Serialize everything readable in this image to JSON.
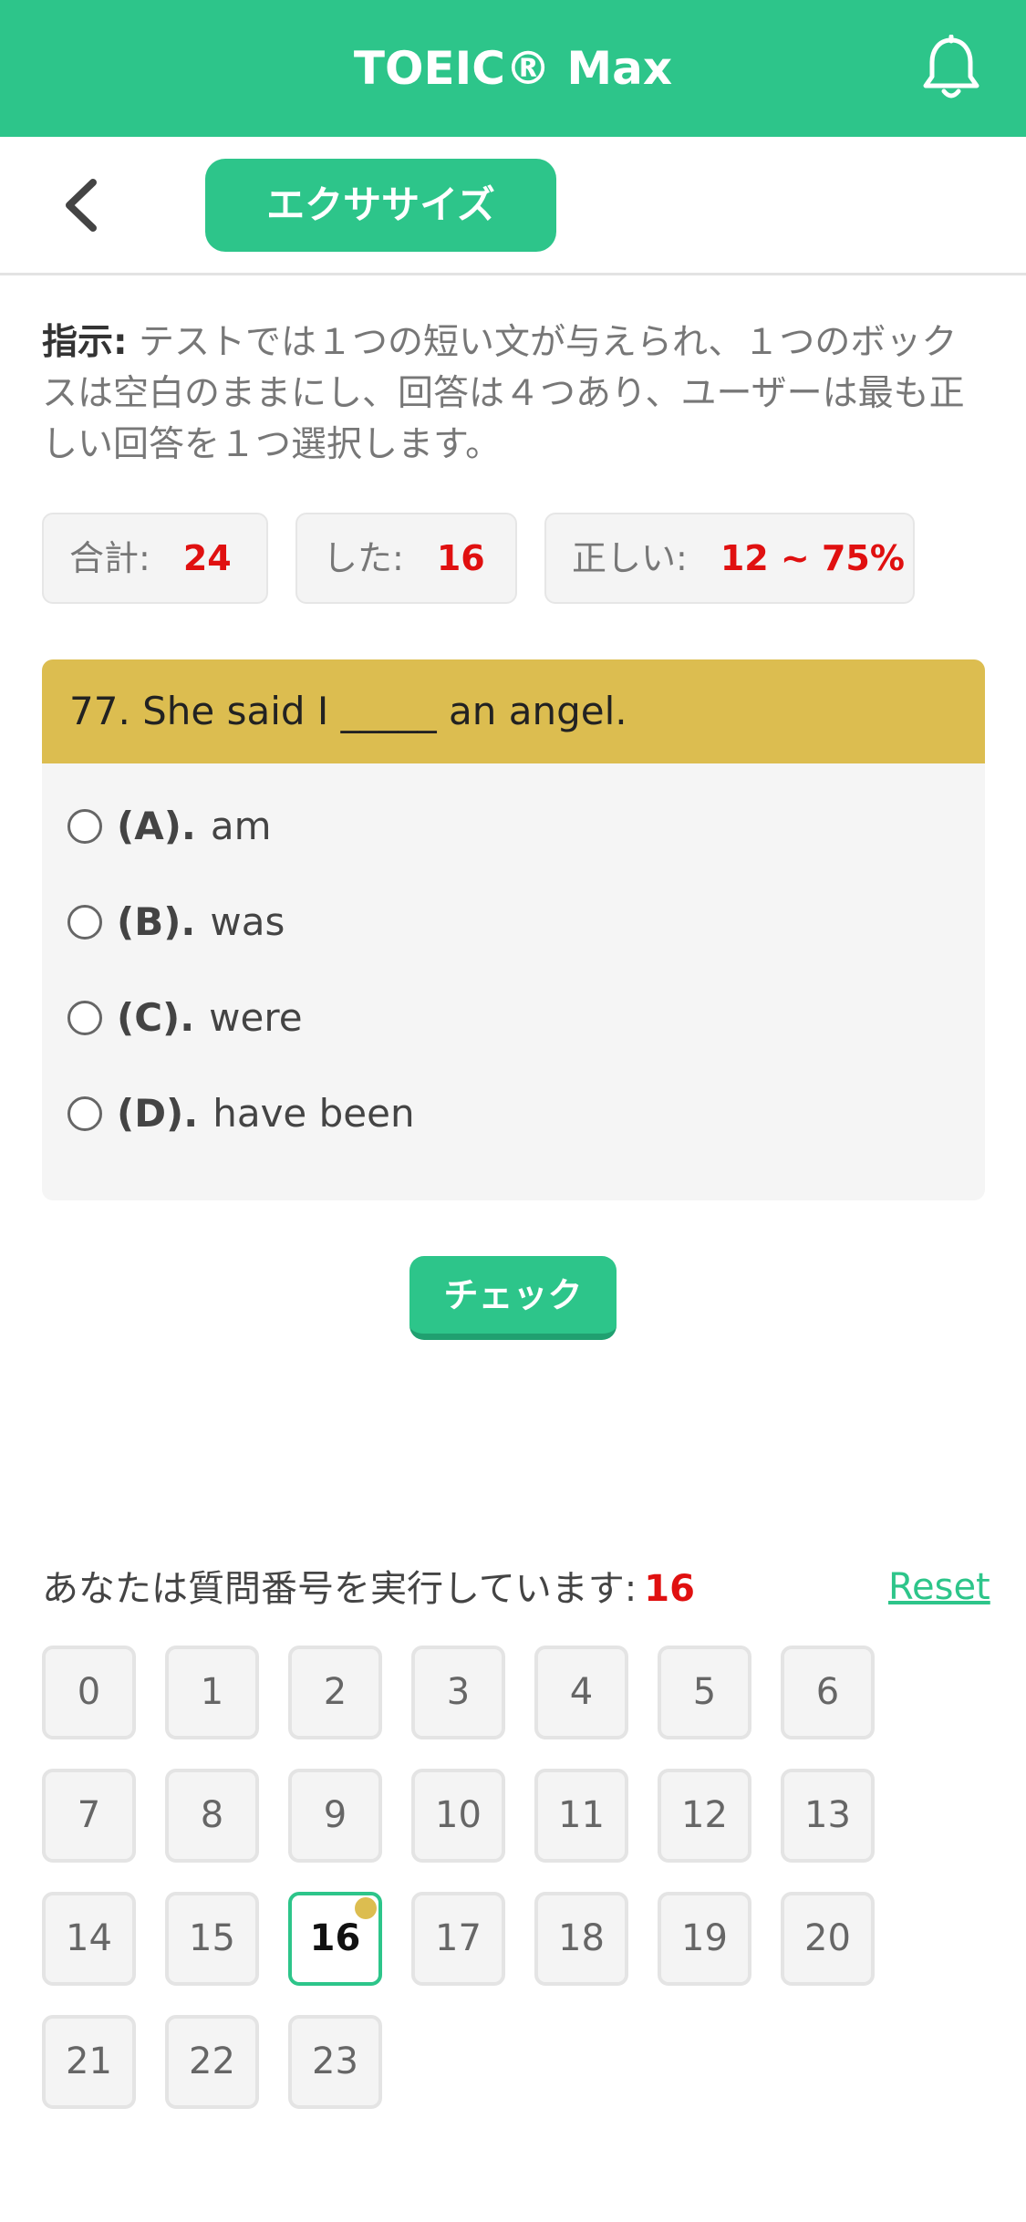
{
  "header": {
    "title": "TOEIC® Max",
    "bell_icon": "bell-icon"
  },
  "subheader": {
    "back_icon": "chevron-left-icon",
    "tab_label": "エクササイズ"
  },
  "instruction": {
    "label": "指示:",
    "text": " テストでは１つの短い文が与えられ、１つのボックスは空白のままにし、回答は４つあり、ユーザーは最も正しい回答を１つ選択します。"
  },
  "stats": {
    "total_label": "合計:",
    "total_value": "24",
    "done_label": "した:",
    "done_value": "16",
    "correct_label": "正しい:",
    "correct_value": "12 ~ 75%"
  },
  "question": {
    "text": "77. She said I _____ an angel.",
    "options": [
      {
        "key": "(A).",
        "text": "am"
      },
      {
        "key": "(B).",
        "text": "was"
      },
      {
        "key": "(C).",
        "text": "were"
      },
      {
        "key": "(D).",
        "text": "have been"
      }
    ]
  },
  "check_button": "チェック",
  "progress": {
    "label": "あなたは質問番号を実行しています:",
    "current": "16",
    "reset_label": "Reset",
    "numbers": [
      "0",
      "1",
      "2",
      "3",
      "4",
      "5",
      "6",
      "7",
      "8",
      "9",
      "10",
      "11",
      "12",
      "13",
      "14",
      "15",
      "16",
      "17",
      "18",
      "19",
      "20",
      "21",
      "22",
      "23"
    ]
  },
  "colors": {
    "brand": "#2dc58a",
    "question_header": "#dcbd50",
    "highlight_number": "#e01010"
  }
}
